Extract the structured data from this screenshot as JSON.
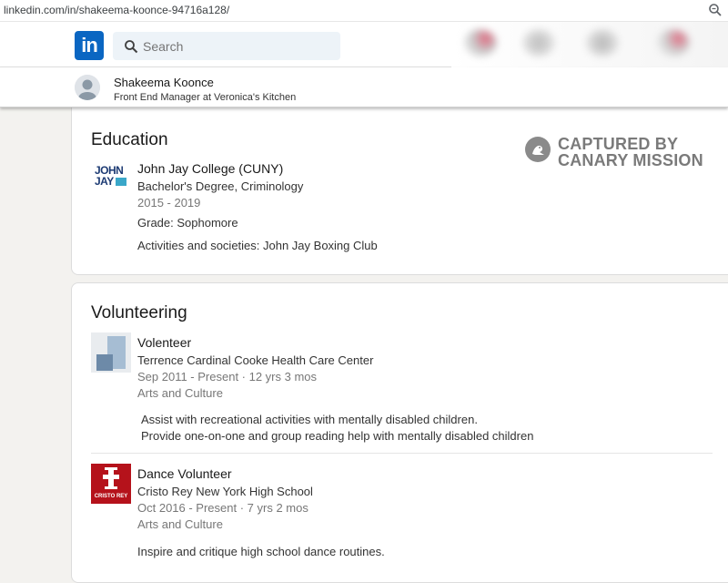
{
  "browser": {
    "url": "linkedin.com/in/shakeema-koonce-94716a128/",
    "zoom_icon": "zoom-magnifier-icon"
  },
  "nav": {
    "logo_text": "in",
    "search_placeholder": "Search"
  },
  "profile": {
    "name": "Shakeema Koonce",
    "headline": "Front End Manager at Veronica's Kitchen"
  },
  "watermark": {
    "line1": "CAPTURED BY",
    "line2": "CANARY MISSION"
  },
  "education": {
    "title": "Education",
    "items": [
      {
        "logo_line1": "JOHN",
        "logo_line2": "JAY",
        "school": "John Jay College (CUNY)",
        "degree": "Bachelor's Degree, Criminology",
        "dates": "2015 - 2019",
        "grade": "Grade: Sophomore",
        "activities": "Activities and societies: John Jay Boxing Club"
      }
    ]
  },
  "volunteering": {
    "title": "Volunteering",
    "items": [
      {
        "role": "Volenteer",
        "org": "Terrence Cardinal Cooke Health Care Center",
        "dates": "Sep 2011 - Present · 12 yrs 3 mos",
        "cause": "Arts and Culture",
        "desc_line1": "Assist with recreational activities with mentally disabled children.",
        "desc_line2": "Provide one-on-one and group reading help with mentally disabled children"
      },
      {
        "role": "Dance Volunteer",
        "org": "Cristo Rey New York High School",
        "dates": "Oct 2016 - Present · 7 yrs 2 mos",
        "cause": "Arts and Culture",
        "desc": "Inspire and critique high school dance routines.",
        "logo_text": "CRISTO REY"
      }
    ]
  },
  "colors": {
    "linkedin_blue": "#0a66c2",
    "cristo_red": "#b5121b",
    "watermark_gray": "#7a7a7a"
  }
}
